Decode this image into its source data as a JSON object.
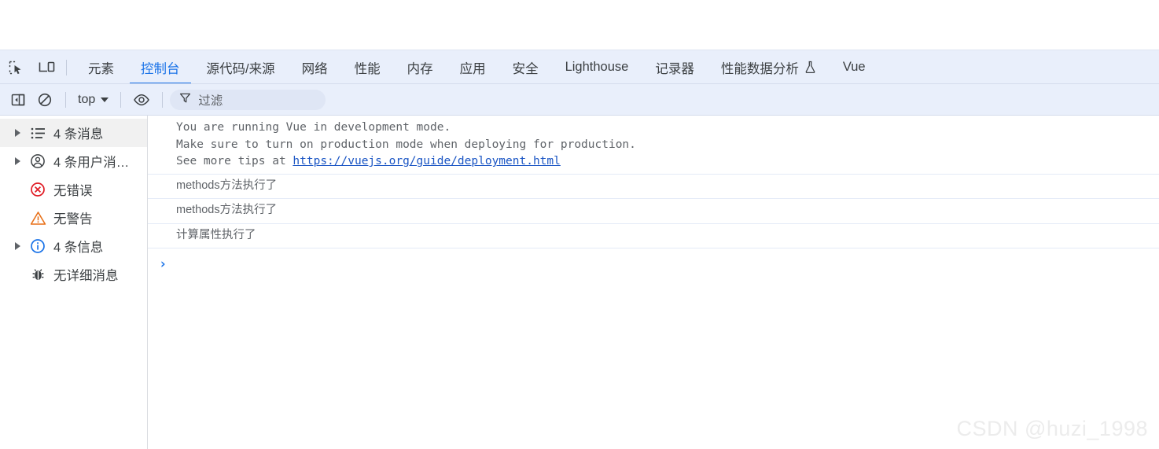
{
  "window": {
    "top_blank": ""
  },
  "tabbar": {
    "inspect_icon": "inspect-element-icon",
    "device_icon": "device-toolbar-icon",
    "tabs": [
      {
        "label": "元素",
        "active": false
      },
      {
        "label": "控制台",
        "active": true
      },
      {
        "label": "源代码/来源",
        "active": false
      },
      {
        "label": "网络",
        "active": false
      },
      {
        "label": "性能",
        "active": false
      },
      {
        "label": "内存",
        "active": false
      },
      {
        "label": "应用",
        "active": false
      },
      {
        "label": "安全",
        "active": false
      },
      {
        "label": "Lighthouse",
        "active": false
      },
      {
        "label": "记录器",
        "active": false
      },
      {
        "label": "性能数据分析",
        "active": false,
        "badge_icon": "flask-icon"
      },
      {
        "label": "Vue",
        "active": false
      }
    ],
    "active_tab_color": "#1a73e8",
    "background": "#e9effb"
  },
  "toolbar": {
    "sidebar_toggle_icon": "console-sidebar-toggle-icon",
    "clear_icon": "clear-console-icon",
    "context_value": "top",
    "eye_icon": "live-expression-eye-icon",
    "filter_icon": "filter-funnel-icon",
    "filter_placeholder": "过滤",
    "filter_value": ""
  },
  "sidebar": {
    "items": [
      {
        "label": "4 条消息",
        "icon": "message-list-icon",
        "expandable": true,
        "selected": true
      },
      {
        "label": "4 条用户消…",
        "icon": "user-message-icon",
        "expandable": true,
        "selected": false
      },
      {
        "label": "无错误",
        "icon": "error-circle-icon",
        "expandable": false,
        "selected": false
      },
      {
        "label": "无警告",
        "icon": "warning-triangle-icon",
        "expandable": false,
        "selected": false
      },
      {
        "label": "4 条信息",
        "icon": "info-circle-icon",
        "expandable": true,
        "selected": false
      },
      {
        "label": "无详细消息",
        "icon": "bug-verbose-icon",
        "expandable": false,
        "selected": false
      }
    ]
  },
  "console": {
    "messages": [
      {
        "type": "multiline",
        "lines": [
          "You are running Vue in development mode.",
          "Make sure to turn on production mode when deploying for production.",
          "See more tips at "
        ],
        "link_text": "https://vuejs.org/guide/deployment.html"
      },
      {
        "type": "single",
        "text": "methods方法执行了"
      },
      {
        "type": "single",
        "text": "methods方法执行了"
      },
      {
        "type": "single",
        "text": "计算属性执行了"
      }
    ],
    "prompt_symbol": "›"
  },
  "watermark": {
    "text": "CSDN @huzi_1998"
  }
}
